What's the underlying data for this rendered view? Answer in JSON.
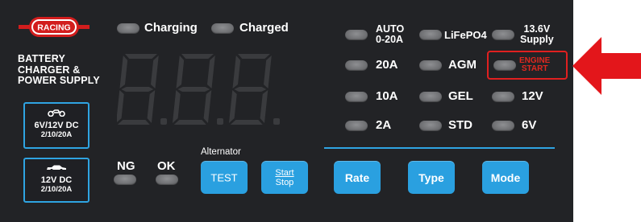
{
  "brand": {
    "logo_text": "RACING",
    "title_lines": [
      "BATTERY",
      "CHARGER &",
      "POWER SUPPLY"
    ]
  },
  "vehicle_modes": [
    {
      "icon": "motorcycle-icon",
      "line1": "6V/12V DC",
      "line2": "2/10/20A"
    },
    {
      "icon": "car-icon",
      "line1": "12V DC",
      "line2": "2/10/20A"
    }
  ],
  "status": {
    "charging_label": "Charging",
    "charged_label": "Charged"
  },
  "display": {
    "digits": "8.8.8.",
    "digit_color": "#3a3b3e"
  },
  "alternator": {
    "label": "Alternator",
    "ng_label": "NG",
    "ok_label": "OK"
  },
  "rate": {
    "auto_line1": "AUTO",
    "auto_line2": "0-20A",
    "options": [
      "20A",
      "10A",
      "2A"
    ]
  },
  "type": {
    "options": [
      "LiFePO4",
      "AGM",
      "GEL",
      "STD"
    ]
  },
  "mode": {
    "supply_line1": "13.6V",
    "supply_line2": "Supply",
    "engine_line1": "ENGINE",
    "engine_line2": "START",
    "options": [
      "12V",
      "6V"
    ]
  },
  "buttons": {
    "test": "TEST",
    "start_line1": "Start",
    "start_line2": "Stop",
    "rate": "Rate",
    "type": "Type",
    "mode": "Mode"
  },
  "colors": {
    "panel": "#222326",
    "accent_blue": "#2aa0e0",
    "engine_red": "#e0281f",
    "arrow_red": "#e3161b",
    "led_off": "#7a7b7e"
  }
}
